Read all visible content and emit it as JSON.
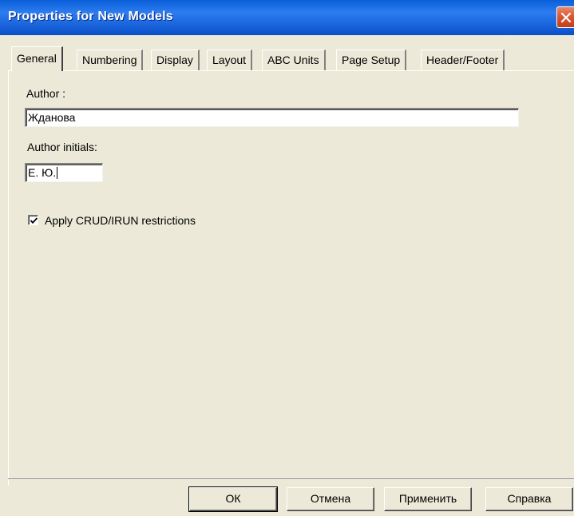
{
  "window": {
    "title": "Properties for New Models",
    "close_icon": "close-x-icon"
  },
  "tabs": [
    {
      "label": "General",
      "active": true
    },
    {
      "label": "Numbering",
      "active": false
    },
    {
      "label": "Display",
      "active": false
    },
    {
      "label": "Layout",
      "active": false
    },
    {
      "label": "ABC Units",
      "active": false
    },
    {
      "label": "Page Setup",
      "active": false
    },
    {
      "label": "Header/Footer",
      "active": false
    }
  ],
  "general": {
    "author_label": "Author :",
    "author_value": "Жданова",
    "initials_label": "Author initials:",
    "initials_value": "Е. Ю.",
    "crud_label": "Apply CRUD/IRUN restrictions",
    "crud_checked": true
  },
  "buttons": {
    "ok": "ОК",
    "cancel": "Отмена",
    "apply": "Применить",
    "help": "Справка"
  },
  "colors": {
    "titlebar": "#0a5fd8",
    "face": "#ece9d8",
    "close": "#d9552e"
  }
}
